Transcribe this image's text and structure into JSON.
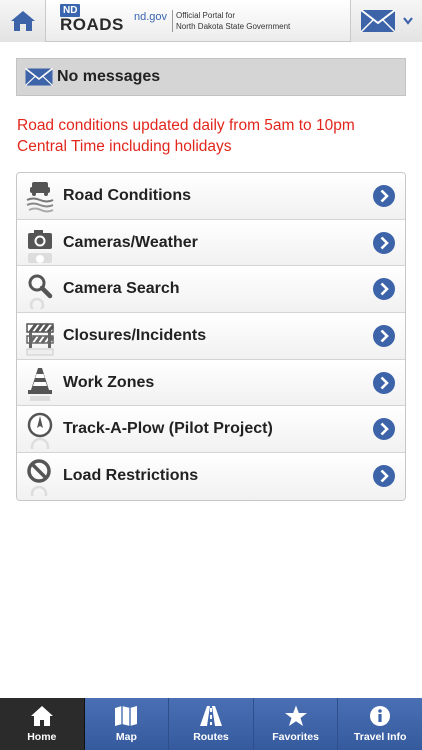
{
  "header": {
    "logo_nd": "ND",
    "logo_roads": "ROADS",
    "logo_gov": "nd.gov",
    "portal_line1": "Official Portal for",
    "portal_line2": "North Dakota State Government"
  },
  "messages": {
    "text": "No messages"
  },
  "notice": {
    "line1": "Road conditions updated daily from 5am to 10pm",
    "line2": "Central Time including holidays"
  },
  "menu": [
    {
      "label": "Road Conditions",
      "icon": "road-conditions-icon"
    },
    {
      "label": "Cameras/Weather",
      "icon": "camera-icon"
    },
    {
      "label": "Camera Search",
      "icon": "magnifier-icon"
    },
    {
      "label": "Closures/Incidents",
      "icon": "barricade-icon"
    },
    {
      "label": "Work Zones",
      "icon": "traffic-cone-icon"
    },
    {
      "label": "Track-A-Plow (Pilot Project)",
      "icon": "compass-icon"
    },
    {
      "label": "Load Restrictions",
      "icon": "prohibited-icon"
    }
  ],
  "tabs": [
    {
      "label": "Home",
      "icon": "home-icon",
      "active": true
    },
    {
      "label": "Map",
      "icon": "map-icon",
      "active": false
    },
    {
      "label": "Routes",
      "icon": "road-icon",
      "active": false
    },
    {
      "label": "Favorites",
      "icon": "star-icon",
      "active": false
    },
    {
      "label": "Travel Info",
      "icon": "info-icon",
      "active": false
    }
  ],
  "colors": {
    "accent_blue": "#3d63a9",
    "notice_red": "#e2261c",
    "active_tab": "#2b2b2b"
  }
}
